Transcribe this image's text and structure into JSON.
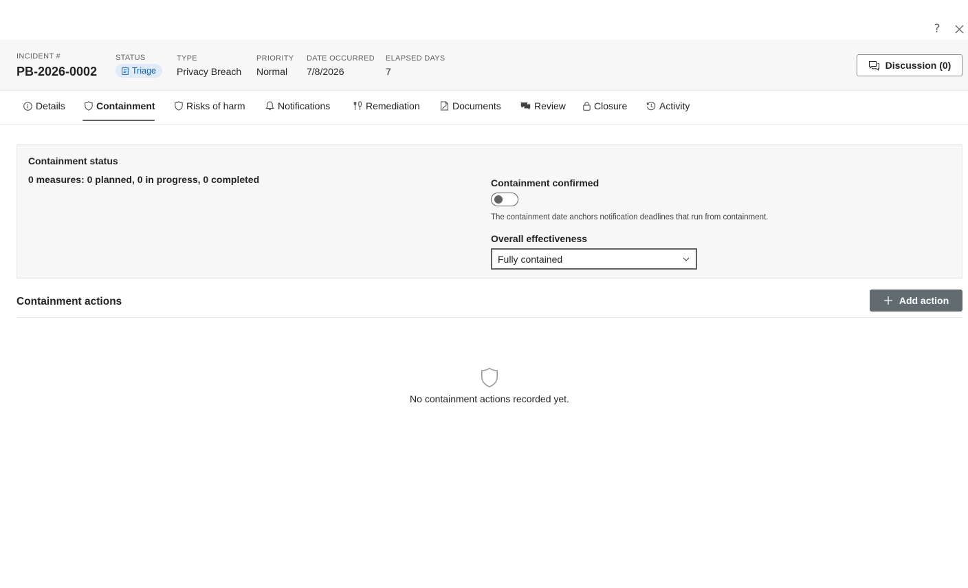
{
  "window": {
    "help_glyph": "?",
    "help_icon": "question-icon",
    "close_icon": "close-icon"
  },
  "header": {
    "incident": {
      "label": "INCIDENT #",
      "value": "PB-2026-0002"
    },
    "status": {
      "label": "STATUS",
      "value": "Triage",
      "icon": "clipboard-icon",
      "color": "#115ea3",
      "bg": "#dfecf8"
    },
    "type": {
      "label": "TYPE",
      "value": "Privacy Breach"
    },
    "priority": {
      "label": "PRIORITY",
      "value": "Normal"
    },
    "date_occurred": {
      "label": "DATE OCCURRED",
      "value": "7/8/2026"
    },
    "elapsed_days": {
      "label": "ELAPSED DAYS",
      "value": "7"
    },
    "discussion_button": {
      "label": "Discussion (0)",
      "icon": "chat-icon"
    }
  },
  "tabs": [
    {
      "label": "Details",
      "icon": "info-icon",
      "active": false
    },
    {
      "label": "Containment",
      "icon": "shield-icon",
      "active": true
    },
    {
      "label": "Risks of harm",
      "icon": "shield-icon",
      "active": false
    },
    {
      "label": "Notifications",
      "icon": "bell-icon",
      "active": false
    },
    {
      "label": "Remediation",
      "icon": "tools-icon",
      "active": false
    },
    {
      "label": "Documents",
      "icon": "document-icon",
      "active": false
    },
    {
      "label": "Review",
      "icon": "comments-icon",
      "active": false
    },
    {
      "label": "Closure",
      "icon": "lock-icon",
      "active": false
    },
    {
      "label": "Activity",
      "icon": "history-icon",
      "active": false
    }
  ],
  "containment_status": {
    "title": "Containment status",
    "summary": "0 measures: 0 planned, 0 in progress, 0 completed",
    "confirmed_label": "Containment confirmed",
    "confirmed": false,
    "hint": "The containment date anchors notification deadlines that run from containment.",
    "effectiveness_label": "Overall effectiveness",
    "effectiveness_value": "Fully contained"
  },
  "containment_actions": {
    "title": "Containment actions",
    "add_button_label": "Add action",
    "add_button_color": "#616b70",
    "empty_icon": "shield-icon",
    "empty_text": "No containment actions recorded yet."
  }
}
